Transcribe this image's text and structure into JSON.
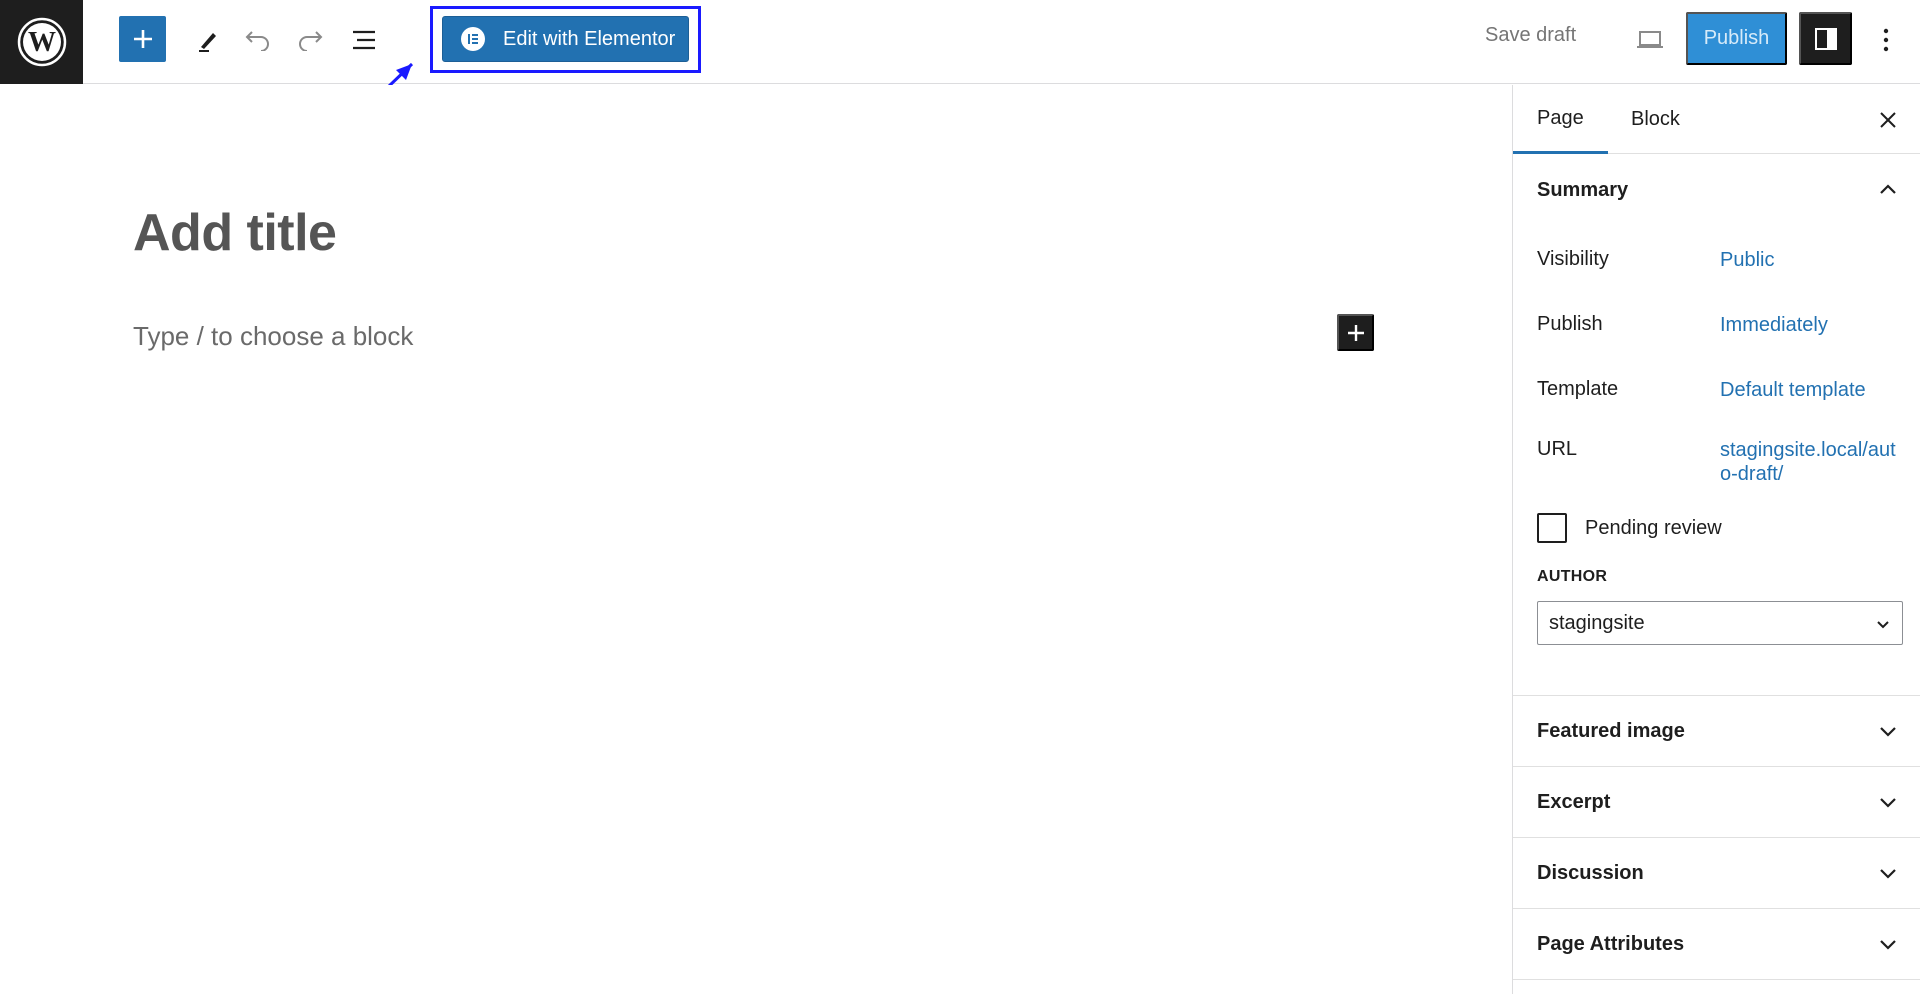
{
  "toolbar": {
    "elementor_label": "Edit with Elementor",
    "save_draft_label": "Save draft",
    "publish_label": "Publish",
    "icons": {
      "logo": "wordpress-logo",
      "add": "plus-icon",
      "tools": "pencil-icon",
      "undo": "undo-icon",
      "redo": "redo-icon",
      "list_view": "list-view-icon",
      "preview": "laptop-icon",
      "settings": "sidebar-toggle-icon",
      "options": "more-vertical-icon"
    }
  },
  "editor": {
    "title_placeholder": "Add title",
    "block_placeholder": "Type / to choose a block"
  },
  "sidebar": {
    "tabs": [
      {
        "label": "Page",
        "active": true
      },
      {
        "label": "Block",
        "active": false
      }
    ],
    "summary": {
      "title": "Summary",
      "rows": [
        {
          "label": "Visibility",
          "value": "Public"
        },
        {
          "label": "Publish",
          "value": "Immediately"
        },
        {
          "label": "Template",
          "value": "Default template"
        },
        {
          "label": "URL",
          "value": "stagingsite.local/auto-draft/"
        }
      ],
      "pending_review_label": "Pending review",
      "author_label": "AUTHOR",
      "author_value": "stagingsite"
    },
    "panels": [
      {
        "title": "Featured image"
      },
      {
        "title": "Excerpt"
      },
      {
        "title": "Discussion"
      },
      {
        "title": "Page Attributes"
      }
    ]
  },
  "colors": {
    "accent": "#2271b1",
    "publish_bg": "#2f8fd6",
    "highlight_border": "#1a1aff",
    "dark": "#1e1e1e"
  }
}
